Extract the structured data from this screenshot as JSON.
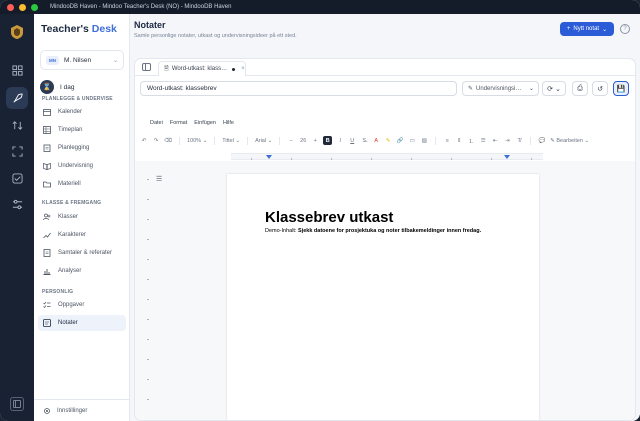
{
  "window": {
    "title": "MindooDB Haven - Mindoo Teacher's Desk (NO) - MindooDB Haven"
  },
  "sidebar": {
    "brand_a": "Teacher's",
    "brand_b": "Desk",
    "user": {
      "initials": "MN",
      "name": "M. Nilsen"
    },
    "today_label": "I dag",
    "sections": [
      {
        "title": "PLANLEGGE & UNDERVISE",
        "items": [
          "Kalender",
          "Timeplan",
          "Planlegging",
          "Undervisning",
          "Materiell"
        ]
      },
      {
        "title": "KLASSE & FREMGANG",
        "items": [
          "Klasser",
          "Karakterer",
          "Samtaler & referater",
          "Analyser"
        ]
      },
      {
        "title": "PERSONLIG",
        "items": [
          "Oppgaver",
          "Notater"
        ]
      }
    ],
    "settings_label": "Innstillinger"
  },
  "main": {
    "title": "Notater",
    "subtitle": "Samle personlige notater, utkast og undervisningsideer på ett sted.",
    "new_button": "Nytt notat",
    "tab_label": "Word-utkast: klass…",
    "note_title": "Word-utkast: klassebrev",
    "category": "Undervisningsi…",
    "menu": [
      "Datei",
      "Format",
      "Einfügen",
      "Hilfe"
    ],
    "toolbar": {
      "zoom": "100%",
      "style": "Tittel",
      "font": "Arial",
      "size": "26",
      "bold": "B",
      "edit_mode": "Bearbeiten"
    },
    "document": {
      "heading": "Klassebrev utkast",
      "body_prefix": "Demo-Inhalt:",
      "body_bold": "Sjekk datoene for prosjektuka og noter tilbakemeldinger innen fredag."
    }
  },
  "colors": {
    "accent": "#2b5bd7",
    "rail": "#182233",
    "titlebar": "#141c2a"
  },
  "icons": [
    "dashboard-icon",
    "rocket-icon",
    "swap-icon",
    "scan-icon",
    "checklist-icon",
    "sliders-icon"
  ]
}
